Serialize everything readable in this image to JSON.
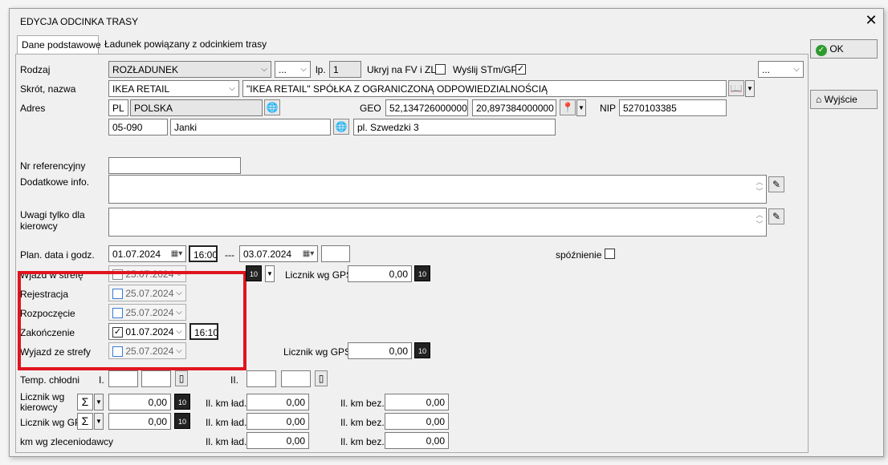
{
  "dialog": {
    "title": "EDYCJA ODCINKA TRASY",
    "close": "✕"
  },
  "tabs": [
    "Dane podstawowe",
    "Ładunek powiązany z odcinkiem trasy"
  ],
  "buttons": {
    "ok": "OK",
    "exit": "Wyjście"
  },
  "rodzaj": {
    "label": "Rodzaj",
    "value": "ROZŁADUNEK",
    "sub": "...",
    "lp_label": "lp.",
    "lp": "1",
    "ukryj": "Ukryj na FV i ZL",
    "wyslij": "Wyślij STm/GPS",
    "right_dd": "..."
  },
  "skrot": {
    "label": "Skrót, nazwa",
    "value": "IKEA RETAIL",
    "name": "\"IKEA RETAIL\" SPÓŁKA Z OGRANICZONĄ ODPOWIEDZIALNOŚCIĄ"
  },
  "adres": {
    "label": "Adres",
    "country_code": "PL",
    "country": "POLSKA",
    "geo_label": "GEO",
    "lat": "52,134726000000",
    "lon": "20,897384000000",
    "nip_label": "NIP",
    "nip": "5270103385",
    "zip": "05-090",
    "city": "Janki",
    "street": "pl. Szwedzki 3"
  },
  "nr_ref": {
    "label": "Nr referencyjny",
    "value": ""
  },
  "dodatkowe": {
    "label": "Dodatkowe info."
  },
  "uwagi": {
    "label": "Uwagi tylko dla kierowcy"
  },
  "plan": {
    "label": "Plan. data i godz.",
    "date_from": "01.07.2024",
    "time_from": "16:00",
    "sep": "---",
    "date_to": "03.07.2024",
    "late": "spóźnienie"
  },
  "events": [
    {
      "label": "Wjazd w strefę",
      "date": "25.07.2024"
    },
    {
      "label": "Rejestracja",
      "date": "25.07.2024"
    },
    {
      "label": "Rozpoczęcie",
      "date": "25.07.2024"
    },
    {
      "label": "Zakończenie",
      "date": "01.07.2024",
      "time": "16:10"
    },
    {
      "label": "Wyjazd ze strefy",
      "date": "25.07.2024"
    }
  ],
  "gps": {
    "label": "Licznik wg GPS",
    "value1": "0,00",
    "value2": "0,00"
  },
  "temp": {
    "label": "Temp. chłodni",
    "i": "I.",
    "ii": "II."
  },
  "counters": {
    "kier_label": "Licznik wg kierowcy",
    "gps_label": "Licznik wg GPS",
    "zlec_label": "km wg zleceniodawcy",
    "v": "0,00",
    "lad": "Il. km ład.",
    "bez": "Il. km bez."
  }
}
